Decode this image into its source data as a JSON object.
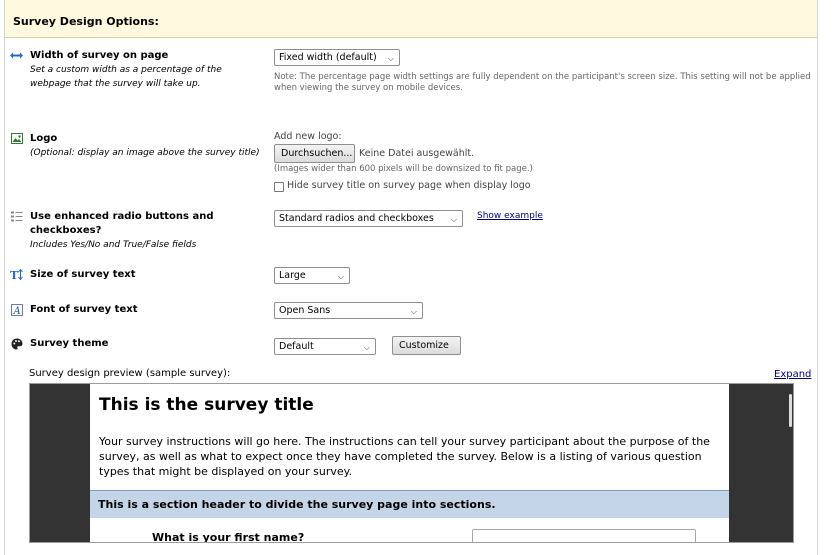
{
  "header": {
    "title": "Survey Design Options:"
  },
  "width": {
    "label": "Width of survey on page",
    "sublabel_1": "Set a custom width as a percentage of the",
    "sublabel_2": "webpage that the survey will take up.",
    "select_value": "Fixed width (default)",
    "note_1": "Note: The percentage page width settings are fully dependent on the participant's screen size. This setting will not be applied",
    "note_2": "when viewing the survey on mobile devices."
  },
  "logo": {
    "label": "Logo",
    "sublabel": "(Optional: display an image above the survey title)",
    "add_label": "Add new logo:",
    "browse_button": "Durchsuchen...",
    "no_file": "Keine Datei ausgewählt.",
    "size_note": "(Images wider than 600 pixels will be downsized to fit page.)",
    "hide_title_label": "Hide survey title on survey page when display logo"
  },
  "radios": {
    "label_1": "Use enhanced radio buttons and",
    "label_2": "checkboxes?",
    "sublabel": "Includes Yes/No and True/False fields",
    "select_value": "Standard radios and checkboxes",
    "show_example": "Show example"
  },
  "text_size": {
    "label": "Size of survey text",
    "select_value": "Large"
  },
  "font": {
    "label": "Font of survey text",
    "select_value": "Open Sans"
  },
  "theme": {
    "label": "Survey theme",
    "select_value": "Default",
    "customize_button": "Customize"
  },
  "preview": {
    "label": "Survey design preview (sample survey):",
    "expand": "Expand",
    "title": "This is the survey title",
    "instructions": "Your survey instructions will go here. The instructions can tell your survey participant about the purpose of the survey, as well as what to expect once they have completed the survey. Below is a listing of various question types that might be displayed on your survey.",
    "section_header": "This is a section header to divide the survey page into sections.",
    "question": "What is your first name?"
  },
  "colors": {
    "header_bg": "#fffadf",
    "link": "#000080",
    "section_bg": "#c5d5e8"
  }
}
